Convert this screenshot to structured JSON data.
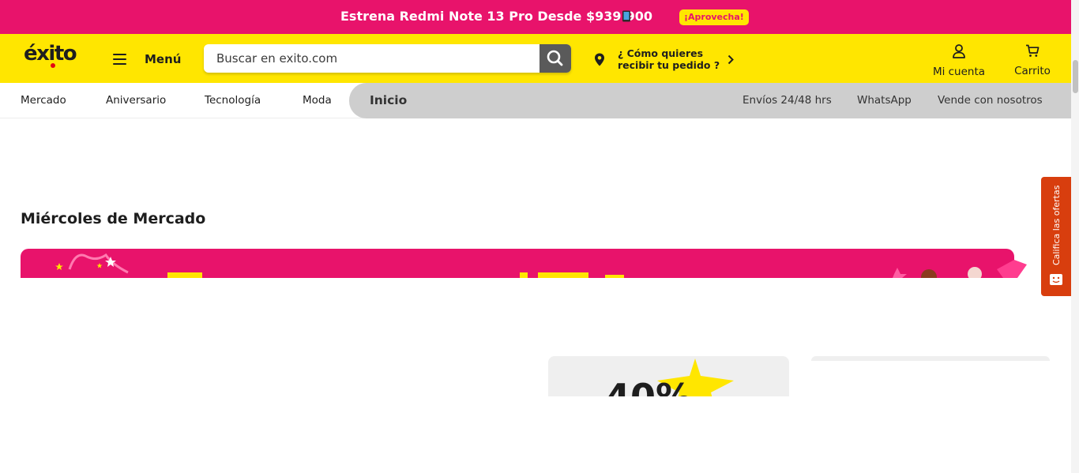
{
  "promo": {
    "text": "Estrena Redmi Note 13 Pro Desde $939.900",
    "cta": "¡Aprovecha!",
    "icon": "phone-icon"
  },
  "header": {
    "logo": "éxito",
    "menu_label": "Menú",
    "search_placeholder": "Buscar en exito.com",
    "delivery_text": "¿ Cómo quieres recibir tu pedido ?",
    "account_label": "Mi cuenta",
    "cart_label": "Carrito"
  },
  "categories": [
    "Mercado",
    "Aniversario",
    "Tecnología",
    "Moda"
  ],
  "active_tab": "Inicio",
  "utility_links": [
    "Envíos 24/48 hrs",
    "WhatsApp",
    "Vende con nosotros"
  ],
  "section": {
    "title": "Miércoles de Mercado"
  },
  "card": {
    "discount_partial": "40%"
  },
  "feedback_tab": {
    "label": "Califica las ofertas"
  },
  "colors": {
    "brand_yellow": "#ffe600",
    "brand_pink": "#e8136b",
    "feedback_orange": "#d83e0e"
  }
}
